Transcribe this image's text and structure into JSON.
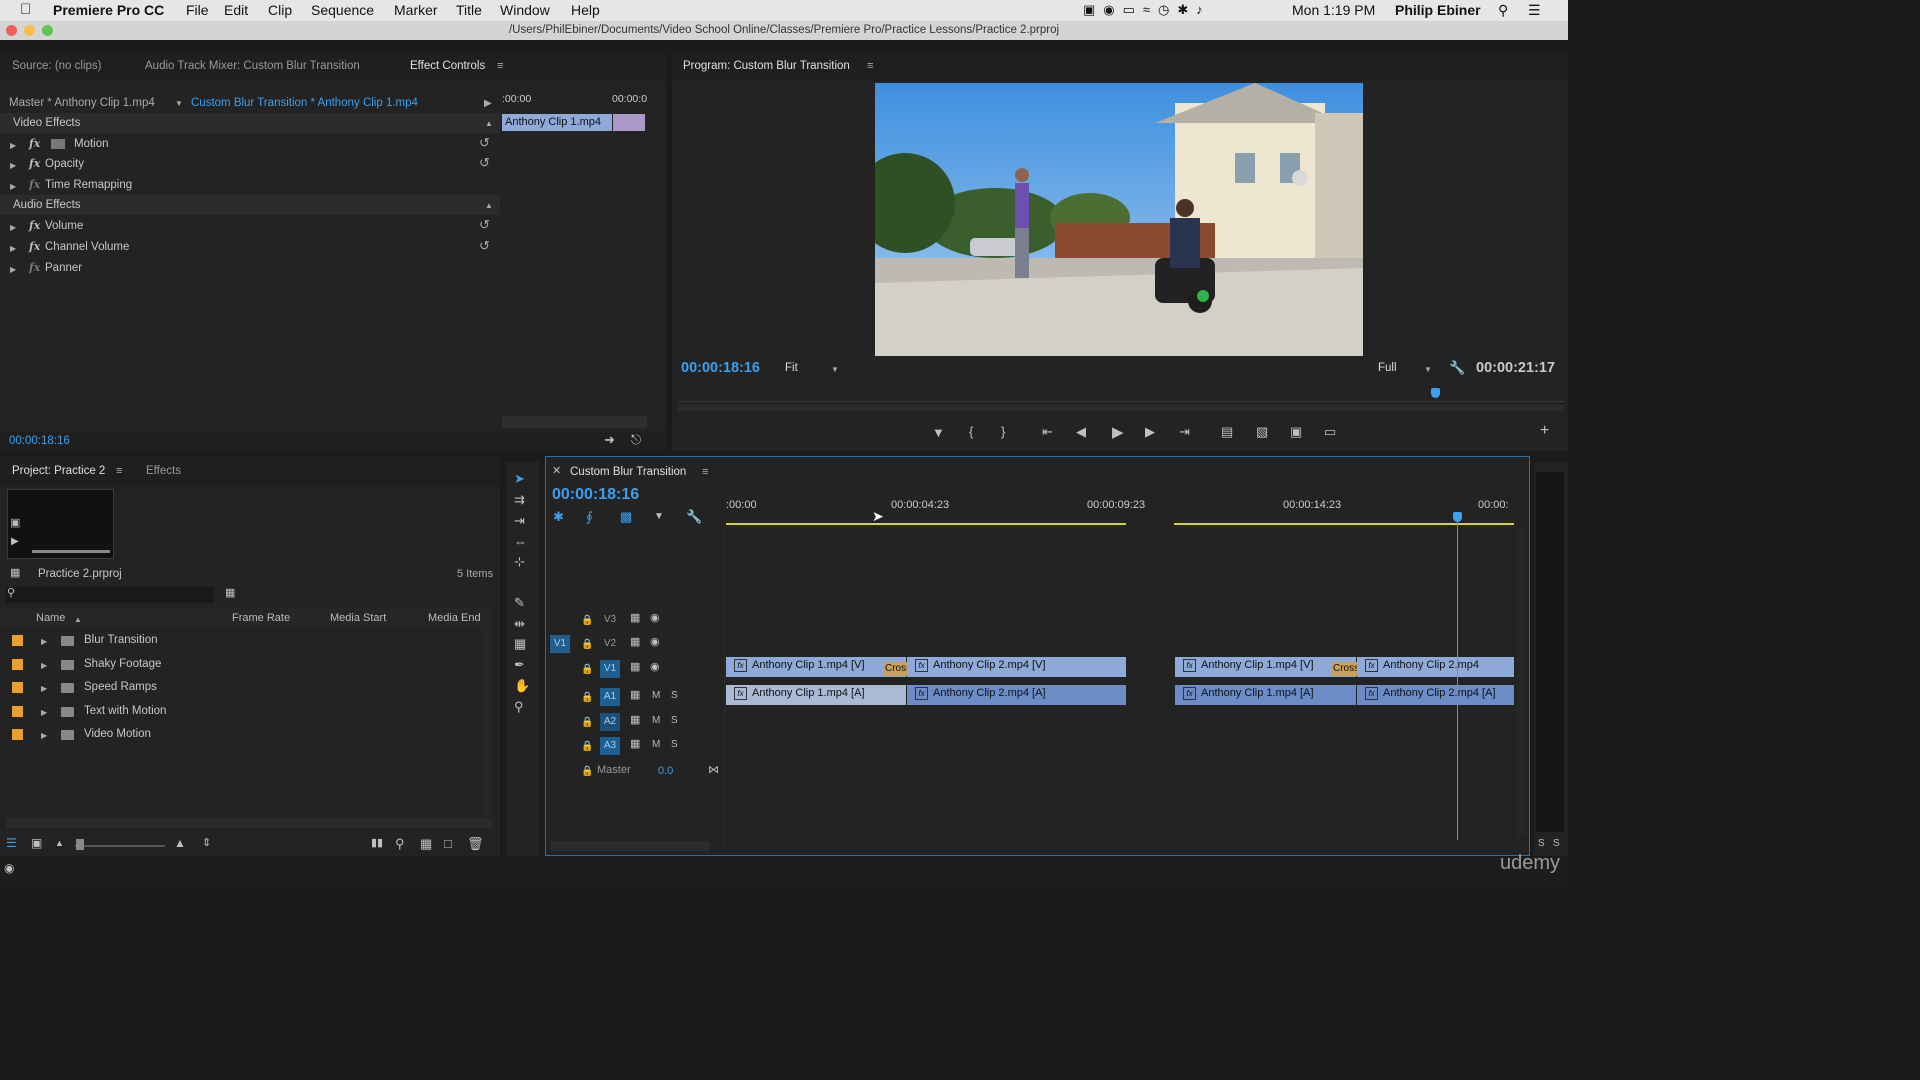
{
  "menubar": {
    "app": "Premiere Pro CC",
    "items": [
      "File",
      "Edit",
      "Clip",
      "Sequence",
      "Marker",
      "Title",
      "Window",
      "Help"
    ],
    "clock": "Mon 1:19 PM",
    "user": "Philip Ebiner"
  },
  "window": {
    "path": "/Users/PhilEbiner/Documents/Video School Online/Classes/Premiere Pro/Practice Lessons/Practice 2.prproj"
  },
  "source_panel": {
    "tabs": [
      "Source: (no clips)",
      "Audio Track Mixer: Custom Blur Transition",
      "Effect Controls"
    ],
    "master_label": "Master * Anthony Clip 1.mp4",
    "sequence_label": "Custom Blur Transition * Anthony Clip 1.mp4",
    "ruler_start": ":00:00",
    "ruler_end": "00:00:0",
    "clip_label": "Anthony Clip 1.mp4",
    "video_effects_header": "Video Effects",
    "video_effects": [
      "Motion",
      "Opacity",
      "Time Remapping"
    ],
    "audio_effects_header": "Audio Effects",
    "audio_effects": [
      "Volume",
      "Channel Volume",
      "Panner"
    ],
    "timecode": "00:00:18:16"
  },
  "program_monitor": {
    "title": "Program: Custom Blur Transition",
    "timecode": "00:00:18:16",
    "fit": "Fit",
    "quality": "Full",
    "duration": "00:00:21:17",
    "playhead_fraction": 0.86
  },
  "project_panel": {
    "tabs": [
      "Project: Practice 2",
      "Effects"
    ],
    "project_file": "Practice 2.prproj",
    "item_count": "5 Items",
    "columns": [
      "Name",
      "Frame Rate",
      "Media Start",
      "Media End"
    ],
    "bins": [
      "Blur Transition",
      "Shaky Footage",
      "Speed Ramps",
      "Text with Motion",
      "Video Motion"
    ],
    "bin_color": "#e8a030"
  },
  "timeline": {
    "title": "Custom Blur Transition",
    "timecode": "00:00:18:16",
    "ruler_labels": [
      ":00:00",
      "00:00:04:23",
      "00:00:09:23",
      "00:00:14:23",
      "00:00:"
    ],
    "tracks_video": [
      "V3",
      "V2",
      "V1"
    ],
    "tracks_audio": [
      "A1",
      "A2",
      "A3"
    ],
    "source_patch": "V1",
    "master_label": "Master",
    "master_value": "0.0",
    "mute_label": "M",
    "solo_label": "S",
    "clips": {
      "v1": [
        {
          "label": "Anthony Clip 1.mp4 [V]"
        },
        {
          "label": "Cross Di"
        },
        {
          "label": "Anthony Clip 2.mp4 [V]"
        },
        {
          "label": "Anthony Clip 1.mp4 [V]"
        },
        {
          "label": "Cross Di"
        },
        {
          "label": "Anthony Clip 2.mp4"
        }
      ],
      "a1": [
        {
          "label": "Anthony Clip 1.mp4 [A]"
        },
        {
          "label": "Anthony Clip 2.mp4 [A]"
        },
        {
          "label": "Anthony Clip 1.mp4 [A]"
        },
        {
          "label": "Anthony Clip 2.mp4 [A]"
        }
      ]
    },
    "meter_labels": [
      "S",
      "S"
    ]
  },
  "watermark": "udemy",
  "colors": {
    "accent": "#3aa0ef",
    "video_clip": "#8fa9d8",
    "audio_clip": "#6b8cc7",
    "transition": "#c8a05a"
  }
}
